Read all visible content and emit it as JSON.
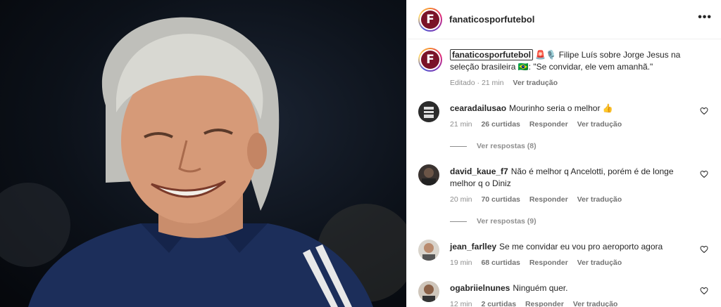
{
  "photo": {
    "description_icon": "person-photo"
  },
  "post": {
    "username": "fanaticosporfutebol",
    "logo_letter": "F",
    "more_icon": "more-options-icon"
  },
  "caption": {
    "username": "fanaticosporfutebol",
    "text": "🚨🎙️ Filipe Luís sobre Jorge Jesus na seleção brasileira 🇧🇷: \"Se convidar, ele vem amanhã.\"",
    "edited": "Editado · 21 min",
    "translate": "Ver tradução"
  },
  "comments": [
    {
      "username": "cearadailusao",
      "text": "Mourinho seria o melhor 👍",
      "time": "21 min",
      "likes": "26 curtidas",
      "reply": "Responder",
      "translate": "Ver tradução",
      "replies": "Ver respostas (8)"
    },
    {
      "username": "david_kaue_f7",
      "text": "Não é melhor q Ancelotti, porém é de longe melhor q o Diniz",
      "time": "20 min",
      "likes": "70 curtidas",
      "reply": "Responder",
      "translate": "Ver tradução",
      "replies": "Ver respostas (9)"
    },
    {
      "username": "jean_farlley",
      "text": "Se me convidar eu vou pro aeroporto agora",
      "time": "19 min",
      "likes": "68 curtidas",
      "reply": "Responder",
      "translate": "Ver tradução"
    },
    {
      "username": "ogabriielnunes",
      "text": "Ninguém quer.",
      "time": "12 min",
      "likes": "2 curtidas",
      "reply": "Responder",
      "translate": "Ver tradução"
    }
  ]
}
